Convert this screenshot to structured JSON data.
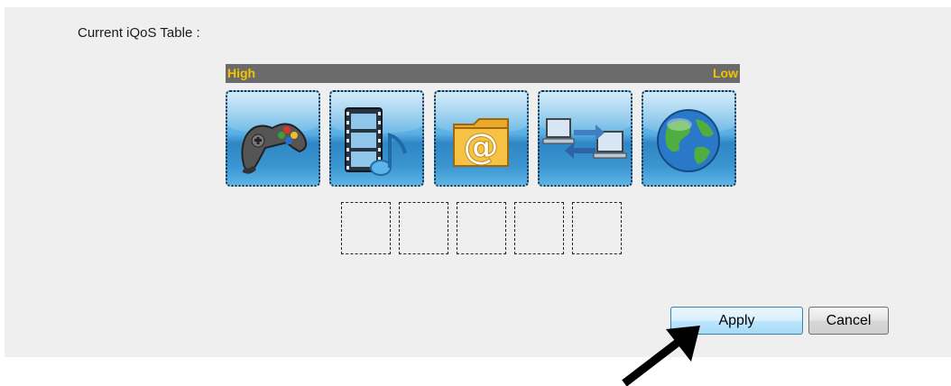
{
  "section": {
    "title": "Current iQoS Table :"
  },
  "priority_bar": {
    "high_label": "High",
    "low_label": "Low",
    "label_color": "#f3c300",
    "bar_color": "#6b6b6b"
  },
  "qos_icons": [
    {
      "icon": "gamepad-icon"
    },
    {
      "icon": "media-film-music-icon"
    },
    {
      "icon": "email-folder-icon"
    },
    {
      "icon": "p2p-computers-icon"
    },
    {
      "icon": "globe-icon"
    }
  ],
  "empty_slots": 5,
  "buttons": {
    "apply_label": "Apply",
    "cancel_label": "Cancel"
  }
}
